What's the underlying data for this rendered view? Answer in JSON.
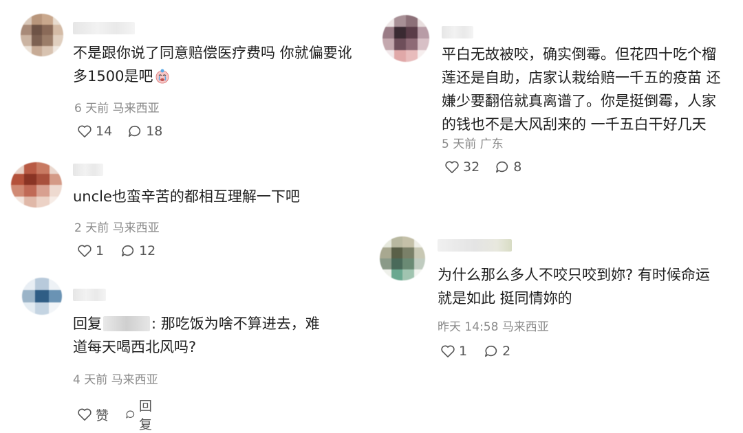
{
  "comments": [
    {
      "text_lines": [
        "不是跟你说了同意赔偿医疗费吗 你就偏要讹",
        "多1500是吧"
      ],
      "time": "6 天前",
      "location": "马来西亚",
      "likes": "14",
      "replies": "18"
    },
    {
      "text_lines": [
        "uncle也蛮辛苦的都相互理解一下吧"
      ],
      "time": "2 天前",
      "location": "马来西亚",
      "likes": "1",
      "replies": "12"
    },
    {
      "reply_prefix": "回复",
      "text_after_mention": ": 那吃饭为啥不算进去，难",
      "text_line2": "道每天喝西北风吗?",
      "time": "4 天前",
      "location": "马来西亚",
      "like_label": "赞",
      "reply_label": "回复"
    },
    {
      "text_lines": [
        "平白无故被咬，确实倒霉。但花四十吃个榴",
        "莲还是自助，店家认栽给赔一千五的疫苗 还",
        "嫌少要翻倍就真离谱了。你是挺倒霉，人家",
        "的钱也不是大风刮来的 一千五白干好几天"
      ],
      "time": "5 天前",
      "location": "广东",
      "likes": "32",
      "replies": "8"
    },
    {
      "text_lines": [
        "为什么那么多人不咬只咬到妳? 有时候命运",
        "就是如此 挺同情妳的"
      ],
      "time": "昨天 14:58",
      "location": "马来西亚",
      "likes": "1",
      "replies": "2"
    }
  ],
  "icons": {
    "like": "heart-outline-icon",
    "reply": "speech-bubble-icon",
    "emoji": "crying-face-emoji"
  },
  "colors": {
    "text": "#1f1f1f",
    "meta": "#8a8a8a",
    "icon": "#555555"
  }
}
